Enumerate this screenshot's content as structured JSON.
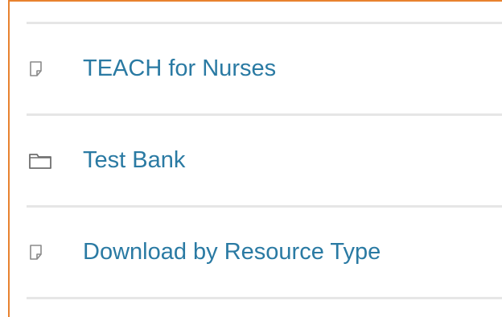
{
  "accent_color": "#e8822f",
  "link_color": "#2a7aa3",
  "items": [
    {
      "label": "TEACH for Nurses",
      "icon": "document-icon"
    },
    {
      "label": "Test Bank",
      "icon": "folder-icon"
    },
    {
      "label": "Download by Resource Type",
      "icon": "document-icon"
    }
  ]
}
